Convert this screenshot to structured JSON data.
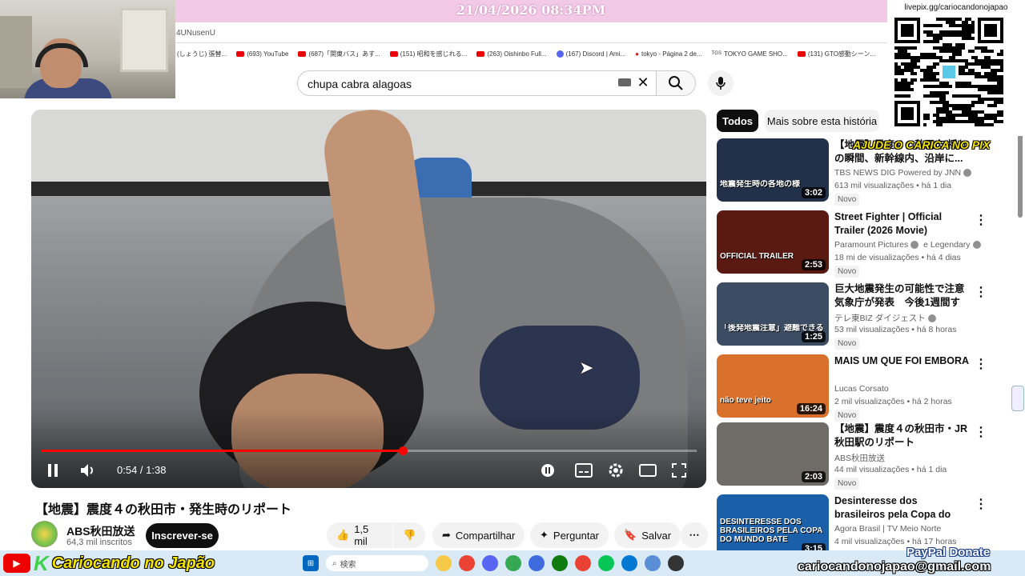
{
  "stream": {
    "datetime": "21/04/2026 08:34PM",
    "qr_url": "livepix.gg/cariocandonojapao",
    "pix_label": "AJUDE O CARICA NO PIX",
    "brand_k": "K",
    "brand_name": "Cariocando no Japão",
    "email": "cariocandonojapao@gmail.com",
    "paypal": "PayPal Donate"
  },
  "browser": {
    "address_fragment": "4UNusenU",
    "bookmarks": [
      {
        "label": "(しょうじ) 張替...",
        "icon": "text"
      },
      {
        "label": "(693) YouTube",
        "icon": "youtube"
      },
      {
        "label": "(687)「関東バス」あす...",
        "icon": "youtube"
      },
      {
        "label": "(151) 昭和を感じれる...",
        "icon": "youtube"
      },
      {
        "label": "(263) Oishinbo Full...",
        "icon": "youtube"
      },
      {
        "label": "(167) Discord | Ami...",
        "icon": "discord"
      },
      {
        "label": "tokyo - Página 2 de...",
        "icon": "apple"
      },
      {
        "label": "TOKYO GAME SHO...",
        "icon": "tgs"
      },
      {
        "label": "(131) GTO感動シーン...",
        "icon": "youtube"
      }
    ]
  },
  "youtube": {
    "search_value": "chupa cabra alagoas",
    "player": {
      "time": "0:54 / 1:38",
      "progress": 0.551
    },
    "video_title": "【地震】震度４の秋田市・発生時のリポート",
    "channel": "ABS秋田放送",
    "subscribers": "64,3 mil inscritos",
    "subscribe_label": "Inscrever-se",
    "likes": "1,5 mil",
    "share_label": "Compartilhar",
    "ask_label": "Perguntar",
    "save_label": "Salvar",
    "chips": {
      "all": "Todos",
      "more": "Mais sobre esta história"
    },
    "recommendations": [
      {
        "title": "【地震】震度４の秋田市 揺れの瞬間、新幹線内、沿岸に...",
        "channel": "TBS NEWS DIG Powered by JNN",
        "verified": true,
        "meta": "613 mil visualizações • há 1 dia",
        "badge": "Novo",
        "duration": "3:02",
        "thumb_color": "#23304a",
        "thumb_caption": "地震発生時の各地の様"
      },
      {
        "title": "Street Fighter | Official Trailer (2026 Movie)",
        "channel": "Paramount Pictures",
        "channel2": "e Legendary",
        "verified": true,
        "meta": "18 mi de visualizações • há 4 dias",
        "badge": "Novo",
        "duration": "2:53",
        "thumb_color": "#5a1a12",
        "thumb_caption": "OFFICIAL TRAILER"
      },
      {
        "title": "巨大地震発生の可能性で注意 気象庁が発表　今後1週間すぐ...",
        "channel": "テレ東BIZ ダイジェスト",
        "verified": true,
        "meta": "53 mil visualizações • há 8 horas",
        "badge": "Novo",
        "duration": "1:25",
        "thumb_color": "#3b4c63",
        "thumb_caption": "「後発地震注意」避難できる"
      },
      {
        "title": "MAIS UM QUE FOI EMBORA",
        "channel": "Lucas Corsato",
        "verified": false,
        "meta": "2 mil visualizações • há 2 horas",
        "badge": "Novo",
        "duration": "16:24",
        "thumb_color": "#d9702b",
        "thumb_caption": "não teve jeito"
      },
      {
        "title": "【地震】震度４の秋田市・JR秋田駅のリポート",
        "channel": "ABS秋田放送",
        "verified": false,
        "meta": "44 mil visualizações • há 1 dia",
        "badge": "Novo",
        "duration": "2:03",
        "thumb_color": "#6f6b66",
        "thumb_caption": ""
      },
      {
        "title": "Desinteresse dos brasileiros pela Copa do Mundo bate ...",
        "channel": "Agora Brasil | TV Meio Norte",
        "verified": false,
        "meta": "4 mil visualizações • há 17 horas",
        "badge": "",
        "duration": "3:15",
        "thumb_color": "#1a5fa8",
        "thumb_caption": "DESINTERESSE DOS BRASILEIROS PELA COPA DO MUNDO BATE RECORDE NO BRASIL"
      }
    ]
  },
  "taskbar": {
    "search_placeholder": "検索",
    "apps": [
      "file-explorer",
      "chrome",
      "discord",
      "chrome-profile",
      "browser",
      "xbox",
      "chrome-active",
      "line",
      "edge",
      "notepad",
      "obs"
    ]
  }
}
